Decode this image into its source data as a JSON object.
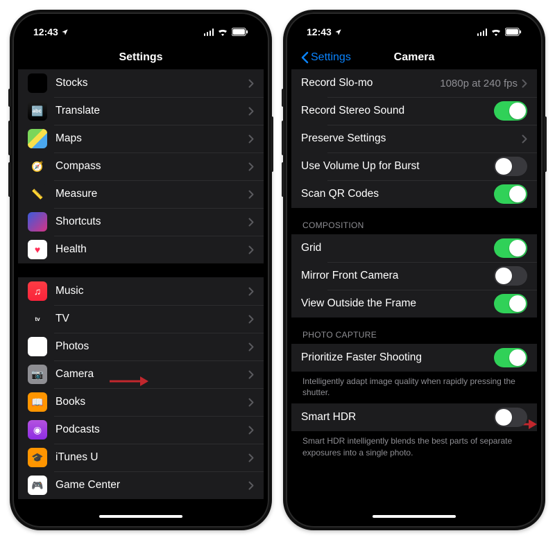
{
  "status": {
    "time": "12:43"
  },
  "left": {
    "title": "Settings",
    "group1": [
      {
        "name": "stocks",
        "label": "Stocks",
        "iconClass": "ic-stocks",
        "glyph": ""
      },
      {
        "name": "translate",
        "label": "Translate",
        "iconClass": "ic-translate",
        "glyph": "🔤"
      },
      {
        "name": "maps",
        "label": "Maps",
        "iconClass": "ic-maps",
        "glyph": ""
      },
      {
        "name": "compass",
        "label": "Compass",
        "iconClass": "ic-compass",
        "glyph": "🧭"
      },
      {
        "name": "measure",
        "label": "Measure",
        "iconClass": "ic-measure",
        "glyph": "📏"
      },
      {
        "name": "shortcuts",
        "label": "Shortcuts",
        "iconClass": "ic-shortcuts",
        "glyph": ""
      },
      {
        "name": "health",
        "label": "Health",
        "iconClass": "ic-health",
        "glyph": "♥"
      }
    ],
    "group2": [
      {
        "name": "music",
        "label": "Music",
        "iconClass": "ic-music",
        "glyph": "♫"
      },
      {
        "name": "tv",
        "label": "TV",
        "iconClass": "ic-tv",
        "glyph": "tv"
      },
      {
        "name": "photos",
        "label": "Photos",
        "iconClass": "ic-photos",
        "glyph": "❀"
      },
      {
        "name": "camera",
        "label": "Camera",
        "iconClass": "ic-camera",
        "glyph": "📷",
        "arrow": true
      },
      {
        "name": "books",
        "label": "Books",
        "iconClass": "ic-books",
        "glyph": "📖"
      },
      {
        "name": "podcasts",
        "label": "Podcasts",
        "iconClass": "ic-podcasts",
        "glyph": "◉"
      },
      {
        "name": "itunesu",
        "label": "iTunes U",
        "iconClass": "ic-itunesu",
        "glyph": "🎓"
      },
      {
        "name": "gamecenter",
        "label": "Game Center",
        "iconClass": "ic-gamecenter",
        "glyph": "🎮"
      }
    ]
  },
  "right": {
    "back": "Settings",
    "title": "Camera",
    "rows1": [
      {
        "name": "record-slomo",
        "label": "Record Slo-mo",
        "type": "link",
        "value": "1080p at 240 fps"
      },
      {
        "name": "record-stereo",
        "label": "Record Stereo Sound",
        "type": "toggle",
        "on": true
      },
      {
        "name": "preserve-settings",
        "label": "Preserve Settings",
        "type": "link"
      },
      {
        "name": "volume-burst",
        "label": "Use Volume Up for Burst",
        "type": "toggle",
        "on": false
      },
      {
        "name": "scan-qr",
        "label": "Scan QR Codes",
        "type": "toggle",
        "on": true
      }
    ],
    "composition_header": "COMPOSITION",
    "rows2": [
      {
        "name": "grid",
        "label": "Grid",
        "type": "toggle",
        "on": true
      },
      {
        "name": "mirror-front",
        "label": "Mirror Front Camera",
        "type": "toggle",
        "on": false
      },
      {
        "name": "view-outside",
        "label": "View Outside the Frame",
        "type": "toggle",
        "on": true
      }
    ],
    "capture_header": "PHOTO CAPTURE",
    "rows3": [
      {
        "name": "prioritize-faster",
        "label": "Prioritize Faster Shooting",
        "type": "toggle",
        "on": true
      }
    ],
    "footer1": "Intelligently adapt image quality when rapidly pressing the shutter.",
    "rows4": [
      {
        "name": "smart-hdr",
        "label": "Smart HDR",
        "type": "toggle",
        "on": false,
        "arrow": true
      }
    ],
    "footer2": "Smart HDR intelligently blends the best parts of separate exposures into a single photo."
  }
}
